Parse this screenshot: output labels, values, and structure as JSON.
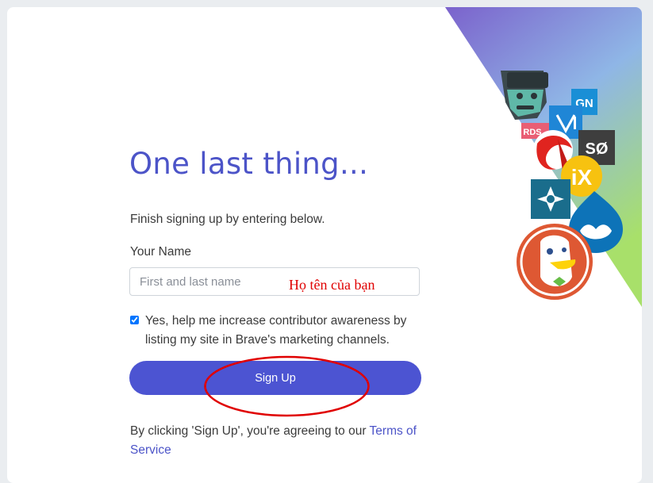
{
  "signup": {
    "title": "One last thing...",
    "subtitle": "Finish signing up by entering below.",
    "name_label": "Your Name",
    "name_placeholder": "First and last name",
    "name_value": "",
    "annotation_text": "Họ tên của bạn",
    "consent_checked": true,
    "consent_text": "Yes, help me increase contributor awareness by listing my site in Brave's marketing channels.",
    "signup_button": "Sign Up",
    "terms_prefix": "By clicking 'Sign Up', you're agreeing to our ",
    "terms_link": "Terms of Service"
  },
  "decoration": {
    "logo_texts": {
      "gn": "GN",
      "sd": "SØ",
      "ix": "iX",
      "rds": "RDS"
    },
    "icons": [
      "nerd-face-icon",
      "gn-logo-icon",
      "mj-logo-icon",
      "red-swirl-logo-icon",
      "sd-logo-icon",
      "ix-logo-icon",
      "star-logo-icon",
      "drupal-drop-icon",
      "duckduckgo-logo-icon"
    ]
  },
  "colors": {
    "accent": "#4c54d2",
    "title": "#4c54c8",
    "annotation": "#e00000",
    "gradient_top": "#7b62cc",
    "gradient_mid": "#8fb6e6",
    "gradient_bottom": "#a8e06a"
  }
}
